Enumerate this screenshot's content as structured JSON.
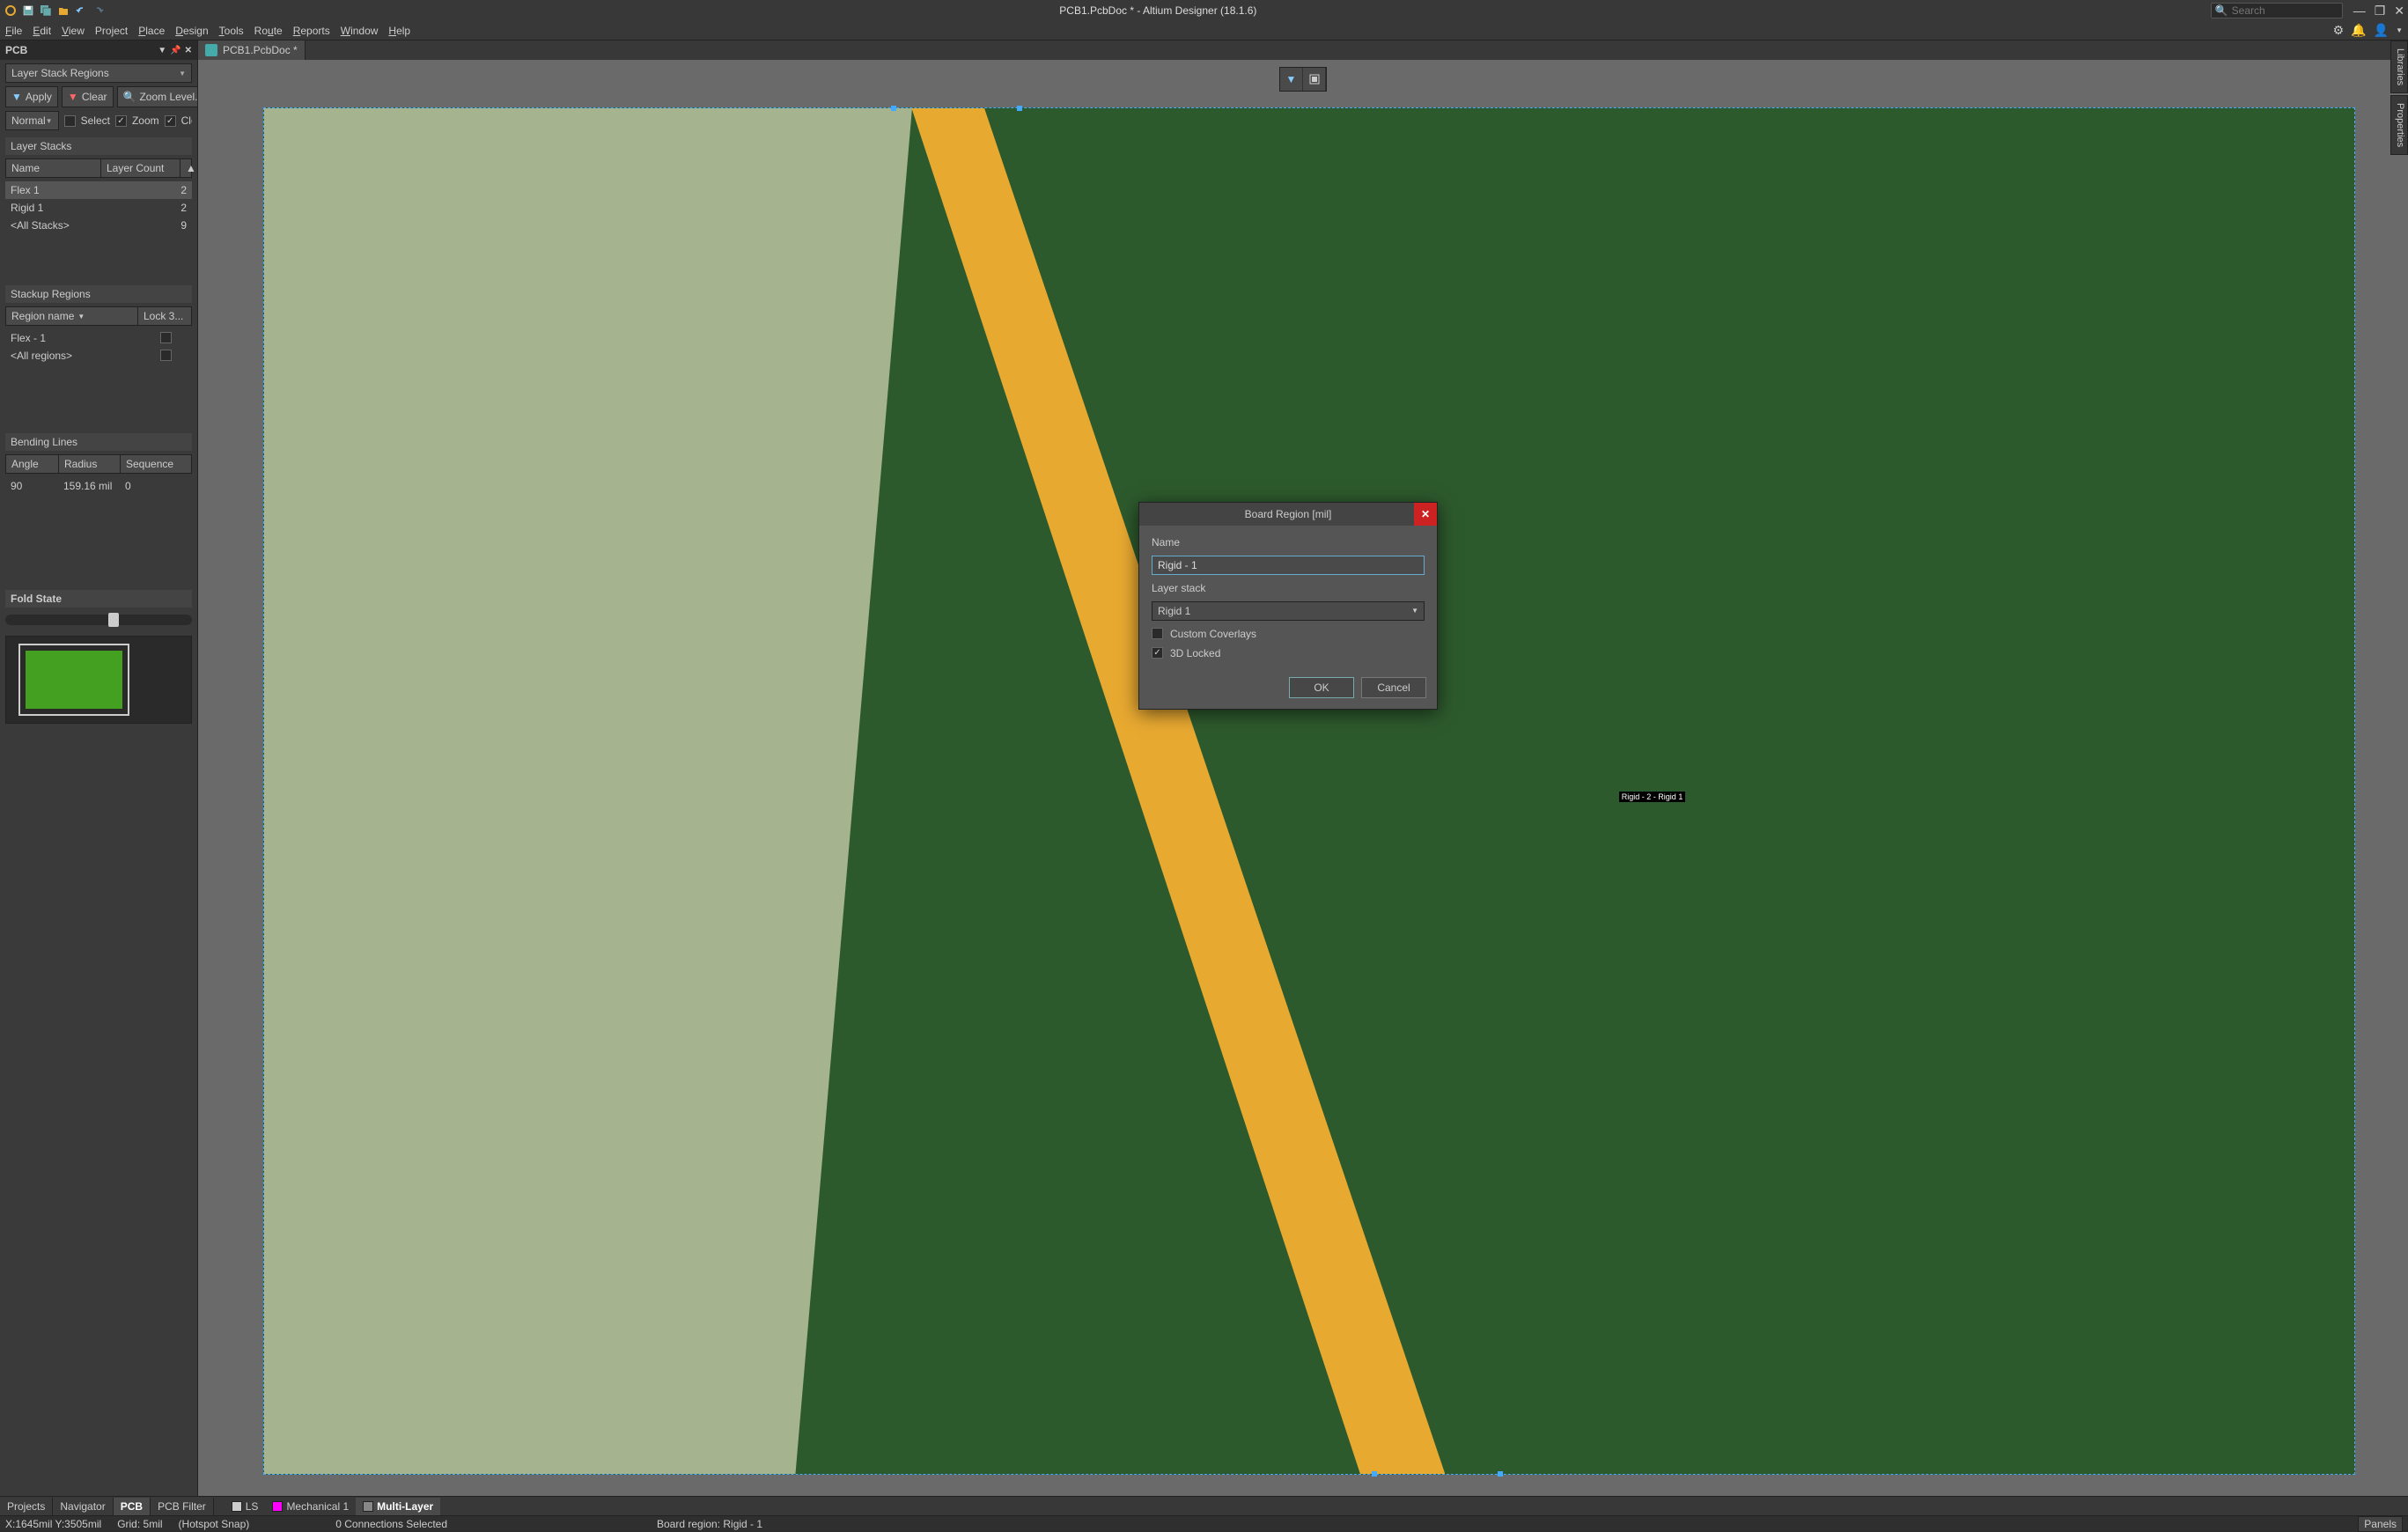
{
  "title": "PCB1.PcbDoc * - Altium Designer (18.1.6)",
  "search_placeholder": "Search",
  "menu": {
    "file": "File",
    "edit": "Edit",
    "view": "View",
    "project": "Project",
    "place": "Place",
    "design": "Design",
    "tools": "Tools",
    "route": "Route",
    "reports": "Reports",
    "window": "Window",
    "help": "Help"
  },
  "doc_tab": "PCB1.PcbDoc *",
  "panel": {
    "title": "PCB",
    "mode": "Layer Stack Regions",
    "apply": "Apply",
    "clear": "Clear",
    "zoom_level": "Zoom Level...",
    "normal": "Normal",
    "select": "Select",
    "zoom": "Zoom",
    "cle": "Cle",
    "layer_stacks_label": "Layer Stacks",
    "ls_head_name": "Name",
    "ls_head_count": "Layer Count",
    "ls_rows": [
      {
        "name": "Flex 1",
        "count": "2"
      },
      {
        "name": "Rigid 1",
        "count": "2"
      },
      {
        "name": "<All Stacks>",
        "count": "9"
      }
    ],
    "stackup_label": "Stackup Regions",
    "sr_head_name": "Region name",
    "sr_head_lock": "Lock 3...",
    "sr_rows": [
      {
        "name": "Flex - 1"
      },
      {
        "name": "<All regions>"
      }
    ],
    "bending_label": "Bending Lines",
    "bl_head_angle": "Angle",
    "bl_head_radius": "Radius",
    "bl_head_seq": "Sequence",
    "bl_rows": [
      {
        "angle": "90",
        "radius": "159.16 mil",
        "seq": "0"
      }
    ],
    "fold_label": "Fold State"
  },
  "board_label": "Rigid - 2 - Rigid 1",
  "dialog": {
    "title": "Board Region [mil]",
    "name_label": "Name",
    "name_value": "Rigid - 1",
    "layer_stack_label": "Layer stack",
    "layer_stack_value": "Rigid 1",
    "custom_coverlays": "Custom Coverlays",
    "locked3d": "3D Locked",
    "ok": "OK",
    "cancel": "Cancel"
  },
  "right_tabs": {
    "libraries": "Libraries",
    "properties": "Properties"
  },
  "bottom_panels": {
    "projects": "Projects",
    "navigator": "Navigator",
    "pcb": "PCB",
    "pcb_filter": "PCB Filter"
  },
  "layers": {
    "ls": "LS",
    "mech": "Mechanical 1",
    "multi": "Multi-Layer"
  },
  "status": {
    "coords": "X:1645mil Y:3505mil",
    "grid": "Grid: 5mil",
    "snap": "(Hotspot Snap)",
    "conn": "0 Connections Selected",
    "region": "Board region: Rigid - 1",
    "panels": "Panels"
  }
}
